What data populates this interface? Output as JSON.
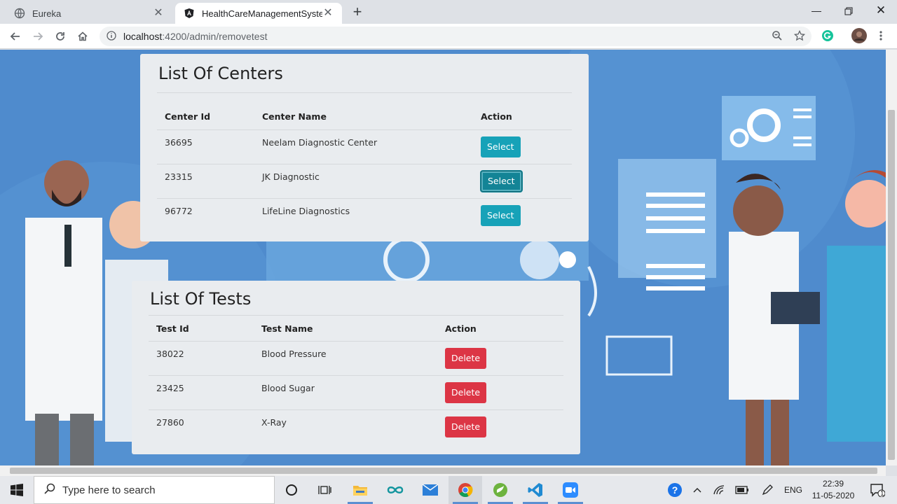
{
  "browser": {
    "tabs": [
      {
        "title": "Eureka",
        "favicon": "globe-icon"
      },
      {
        "title": "HealthCareManagementSystem",
        "favicon": "angular-icon"
      }
    ],
    "url_host": "localhost",
    "url_path": ":4200/admin/removetest"
  },
  "centers": {
    "heading": "List Of Centers",
    "columns": [
      "Center Id",
      "Center Name",
      "Action"
    ],
    "rows": [
      {
        "id": "36695",
        "name": "Neelam Diagnostic Center",
        "action": "Select"
      },
      {
        "id": "23315",
        "name": "JK Diagnostic",
        "action": "Select"
      },
      {
        "id": "96772",
        "name": "LifeLine Diagnostics",
        "action": "Select"
      }
    ]
  },
  "tests": {
    "heading": "List Of Tests",
    "columns": [
      "Test Id",
      "Test Name",
      "Action"
    ],
    "rows": [
      {
        "id": "38022",
        "name": "Blood Pressure",
        "action": "Delete"
      },
      {
        "id": "23425",
        "name": "Blood Sugar",
        "action": "Delete"
      },
      {
        "id": "27860",
        "name": "X-Ray",
        "action": "Delete"
      }
    ]
  },
  "taskbar": {
    "search_placeholder": "Type here to search",
    "language": "ENG",
    "time": "22:39",
    "date": "11-05-2020",
    "notification_count": "1"
  },
  "colors": {
    "select_button": "#17a2b8",
    "delete_button": "#dc3545",
    "card_background": "#e9ecef",
    "page_background": "#4a86c8"
  }
}
